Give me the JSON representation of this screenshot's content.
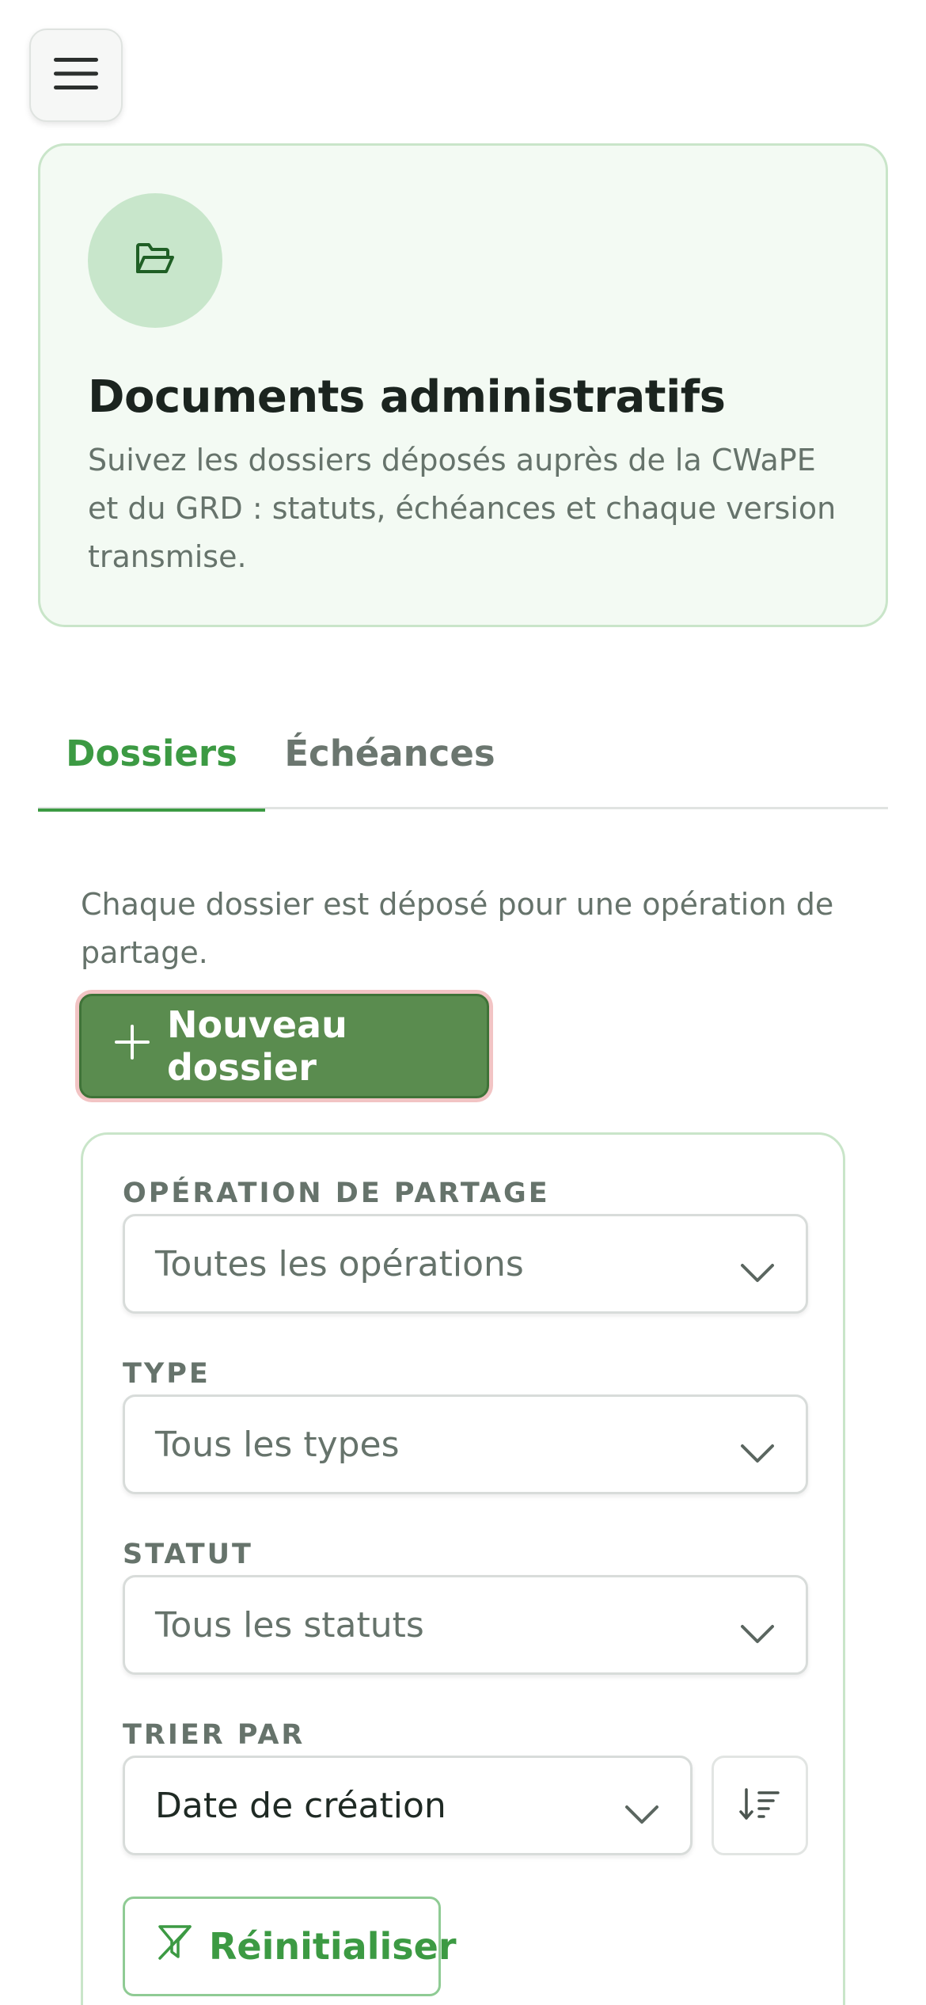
{
  "header": {
    "menu_icon": "hamburger-icon"
  },
  "hero": {
    "icon": "folder-open-icon",
    "title": "Documents administratifs",
    "description": "Suivez les dossiers déposés auprès de la CWaPE et du GRD : statuts, échéances et chaque version transmise."
  },
  "tabs": [
    {
      "label": "Dossiers",
      "active": true
    },
    {
      "label": "Échéances",
      "active": false
    }
  ],
  "main": {
    "intro": "Chaque dossier est déposé pour une opération de partage.",
    "new_button": "Nouveau dossier"
  },
  "filters": {
    "operation": {
      "label": "OPÉRATION DE PARTAGE",
      "value": "Toutes les opérations"
    },
    "type": {
      "label": "TYPE",
      "value": "Tous les types"
    },
    "status": {
      "label": "STATUT",
      "value": "Tous les statuts"
    },
    "sort": {
      "label": "TRIER PAR",
      "value": "Date de création",
      "direction_icon": "sort-descending-icon"
    },
    "reset_button": "Réinitialiser"
  },
  "colors": {
    "accent": "#3c9a43",
    "primary_button": "#5a8c4f",
    "hero_bg": "#f3faf3",
    "border_green": "#c9e5c9"
  }
}
